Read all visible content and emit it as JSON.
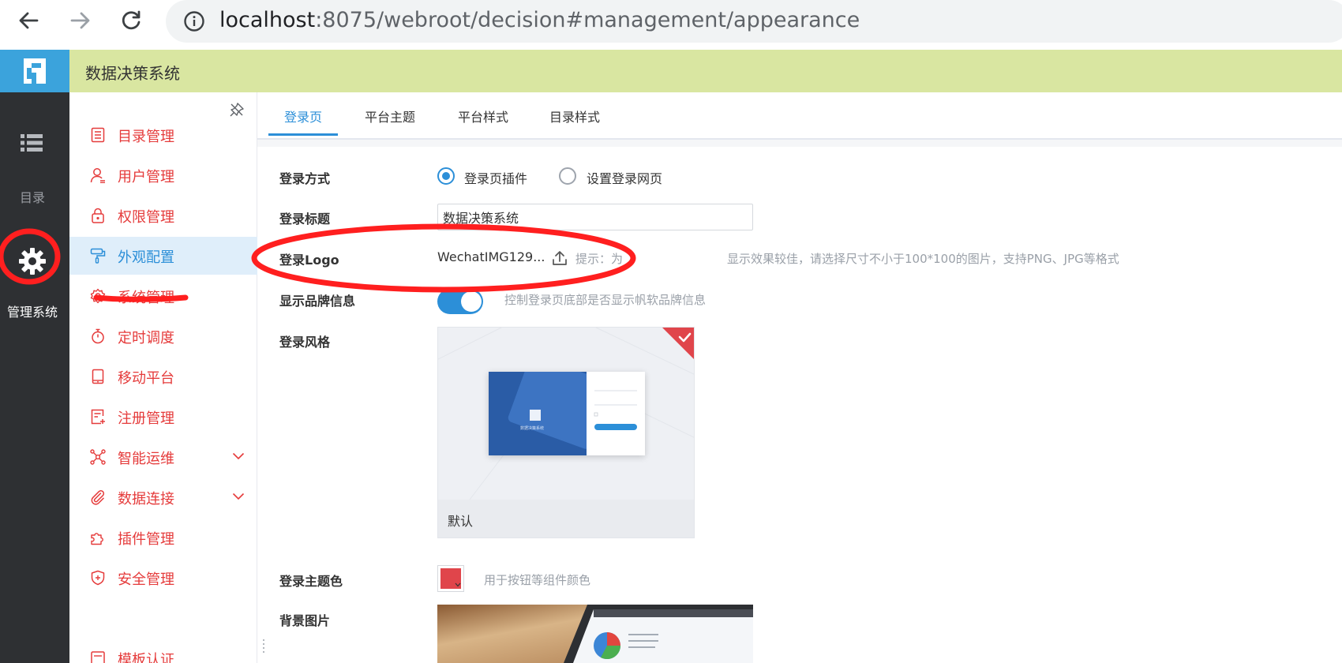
{
  "browser": {
    "url_host": "localhost",
    "url_rest": ":8075/webroot/decision#management/appearance"
  },
  "app": {
    "title": "数据决策系统"
  },
  "rail": {
    "catalog_label": "目录",
    "manage_label": "管理系统"
  },
  "sidebar": {
    "items": [
      {
        "label": "目录管理",
        "icon": "list-icon"
      },
      {
        "label": "用户管理",
        "icon": "user-icon"
      },
      {
        "label": "权限管理",
        "icon": "lock-icon"
      },
      {
        "label": "外观配置",
        "icon": "paint-roller-icon",
        "active": true
      },
      {
        "label": "系统管理",
        "icon": "gear-icon"
      },
      {
        "label": "定时调度",
        "icon": "stopwatch-icon"
      },
      {
        "label": "移动平台",
        "icon": "tablet-icon"
      },
      {
        "label": "注册管理",
        "icon": "register-icon"
      },
      {
        "label": "智能运维",
        "icon": "network-icon",
        "expandable": true
      },
      {
        "label": "数据连接",
        "icon": "paperclip-icon",
        "expandable": true
      },
      {
        "label": "插件管理",
        "icon": "puzzle-icon"
      },
      {
        "label": "安全管理",
        "icon": "shield-icon"
      },
      {
        "label": "模板认证",
        "icon": "template-icon"
      }
    ]
  },
  "tabs": [
    {
      "label": "登录页",
      "active": true
    },
    {
      "label": "平台主题"
    },
    {
      "label": "平台样式"
    },
    {
      "label": "目录样式"
    }
  ],
  "form": {
    "login_method": {
      "label": "登录方式",
      "options": [
        "登录页插件",
        "设置登录网页"
      ],
      "selected": "登录页插件"
    },
    "login_title": {
      "label": "登录标题",
      "value": "数据决策系统"
    },
    "login_logo": {
      "label": "登录Logo",
      "file_name": "WechatIMG129...",
      "hint_prefix": "提示：",
      "hint_prefix_tail": "为",
      "hint_body": "显示效果较佳，请选择尺寸不小于100*100的图片，支持PNG、JPG等格式"
    },
    "brand_info": {
      "label": "显示品牌信息",
      "enabled": true,
      "hint": "控制登录页底部是否显示帆软品牌信息"
    },
    "login_style": {
      "label": "登录风格",
      "card_label": "默认",
      "preview_caption": "数据决策系统"
    },
    "theme_color": {
      "label": "登录主题色",
      "color": "#e0454b",
      "hint": "用于按钮等组件颜色"
    },
    "background_image": {
      "label": "背景图片"
    }
  },
  "colors": {
    "accent": "#2c8fd8",
    "header_bg": "#d9e6a1",
    "rail_bg": "#2e3033",
    "sidebar_text": "#e53b3b",
    "annotation": "#ff1f1f"
  }
}
